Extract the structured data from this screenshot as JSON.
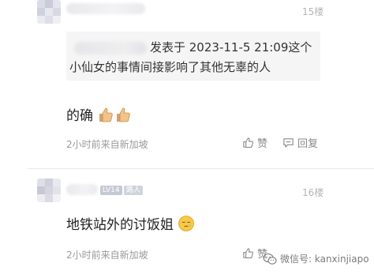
{
  "comments": [
    {
      "floor": "15楼",
      "quote": {
        "prefix": "发表于 2023-11-5 21:09这个",
        "line2": "小仙女的事情间接影响了其他无辜的人"
      },
      "text": "的确",
      "emoji": [
        "thumbs-up-icon",
        "thumbs-up-icon"
      ],
      "time_source": "2小时前来自新加坡",
      "like_label": "赞",
      "reply_label": "回复"
    },
    {
      "floor": "16楼",
      "level_badge": "LV14",
      "role_badge": "路人",
      "text": "地铁站外的讨饭姐",
      "emoji": [
        "sleepy-face-icon"
      ],
      "time_source": "2小时前来自新加坡",
      "like_label": "赞",
      "reply_label": "回复"
    }
  ],
  "watermark": {
    "label": "微信号: kanxinjiapo",
    "icon": "wechat-icon"
  },
  "colors": {
    "level_badge": "#c5c9d6",
    "role_badge": "#cfd3dc",
    "text_primary": "#222222",
    "text_meta": "#9a9a9a"
  }
}
